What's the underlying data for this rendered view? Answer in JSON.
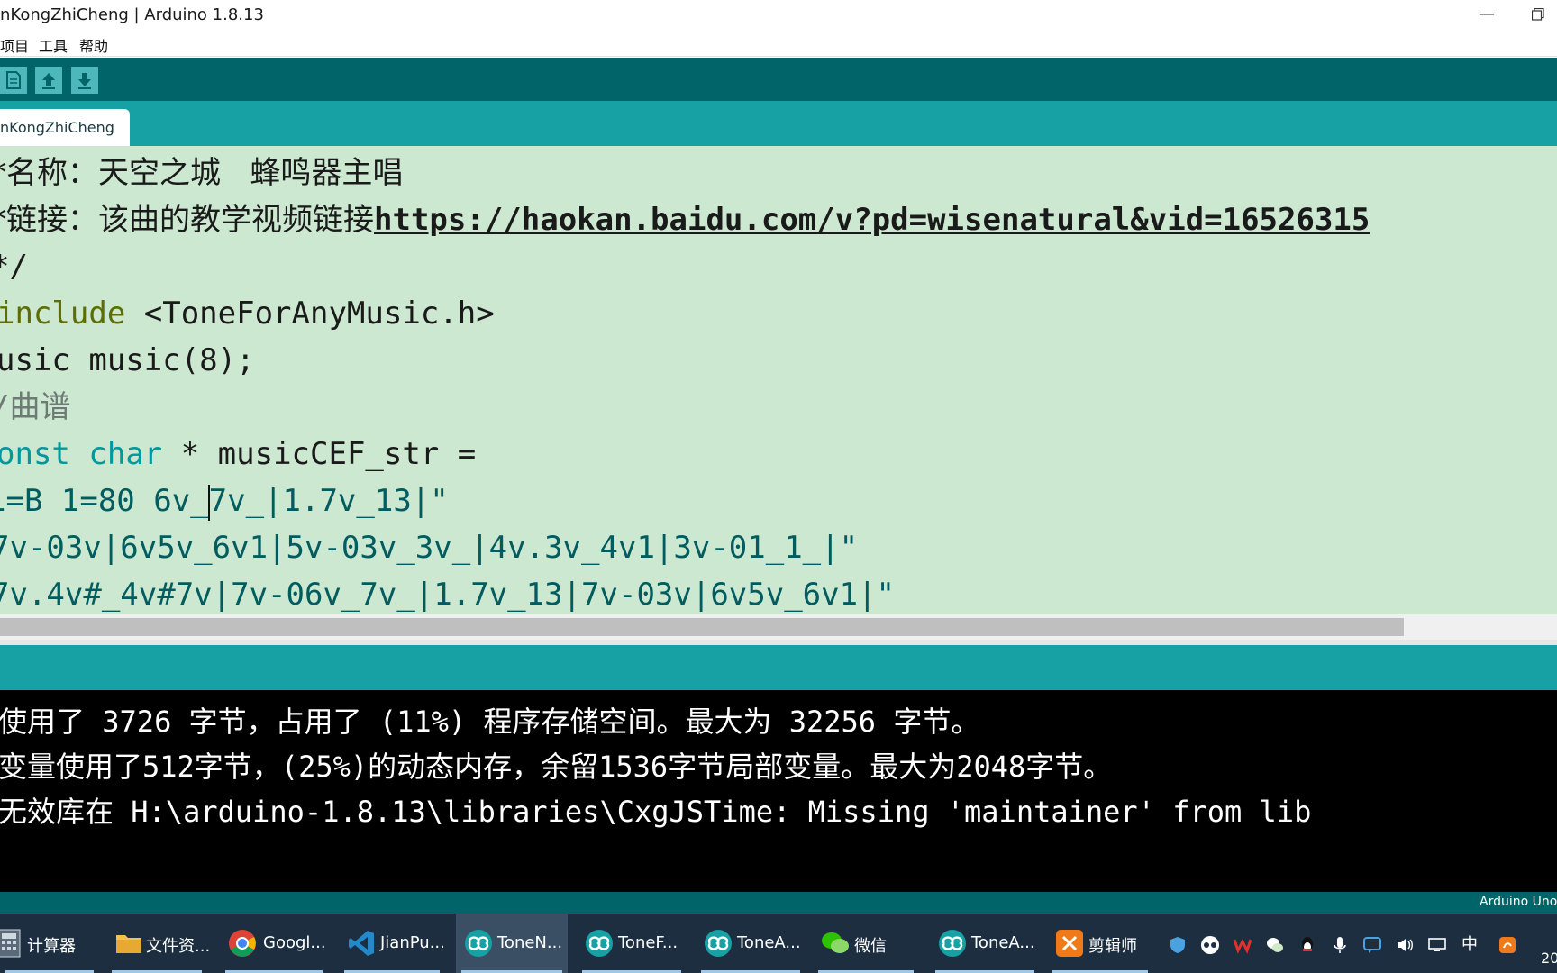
{
  "window": {
    "title": "nKongZhiCheng | Arduino 1.8.13"
  },
  "menu": {
    "items": [
      "项目",
      "工具",
      "帮助"
    ]
  },
  "toolbar": {
    "buttons": [
      "new-icon",
      "open-icon",
      "save-icon"
    ]
  },
  "tab": {
    "label": "nKongZhiCheng"
  },
  "editor": {
    "lines": {
      "l1": "*名称：天空之城   蜂鸣器主唱",
      "l2_text": "*链接：该曲的教学视频链接",
      "l2_url": "https://haokan.baidu.com/v?pd=wisenatural&vid=16526315",
      "l3": "*/",
      "l4_kw": "include",
      "l4_rest": " <ToneForAnyMusic.h>",
      "l5": "usic music(8);",
      "l6_slash": "/",
      "l6_text": "曲谱",
      "l7_kw1": "onst",
      "l7_kw2": "char",
      "l7_rest": " * musicCEF_str =",
      "l8_a": "1=B 1=80 6v_",
      "l8_b": "7v_|1.7v_13|\"",
      "l9": "7v-03v|6v5v_6v1|5v-03v_3v_|4v.3v_4v1|3v-01_1_|\"",
      "l10": "7v.4v#_4v#7v|7v-06v_7v_|1.7v_13|7v-03v|6v5v_6v1|\""
    }
  },
  "console": {
    "lines": [
      "使用了 3726 字节，占用了 (11%) 程序存储空间。最大为 32256 字节。",
      "变量使用了512字节，(25%)的动态内存，余留1536字节局部变量。最大为2048字节。",
      "无效库在 H:\\arduino-1.8.13\\libraries\\CxgJSTime: Missing 'maintainer' from lib"
    ]
  },
  "status": {
    "board": "Arduino Uno"
  },
  "taskbar": {
    "tasks": [
      {
        "label": "计算器",
        "icon": "calculator-icon"
      },
      {
        "label": "文件资...",
        "icon": "folder-icon"
      },
      {
        "label": "Googl...",
        "icon": "chrome-icon"
      },
      {
        "label": "JianPu...",
        "icon": "vscode-icon"
      },
      {
        "label": "ToneN...",
        "icon": "arduino-icon"
      },
      {
        "label": "ToneF...",
        "icon": "arduino-icon"
      },
      {
        "label": "ToneA...",
        "icon": "arduino-icon"
      },
      {
        "label": "微信",
        "icon": "wechat-icon"
      },
      {
        "label": "ToneA...",
        "icon": "arduino-icon"
      },
      {
        "label": "剪辑师",
        "icon": "editor-app-icon"
      }
    ],
    "tray_ime": "中",
    "clock_partial": "20"
  },
  "colors": {
    "teal_dark": "#006468",
    "teal": "#17a1a5",
    "editor_bg": "#cce8d0",
    "keyword_olive": "#5e6d03",
    "keyword_teal": "#00979d"
  }
}
